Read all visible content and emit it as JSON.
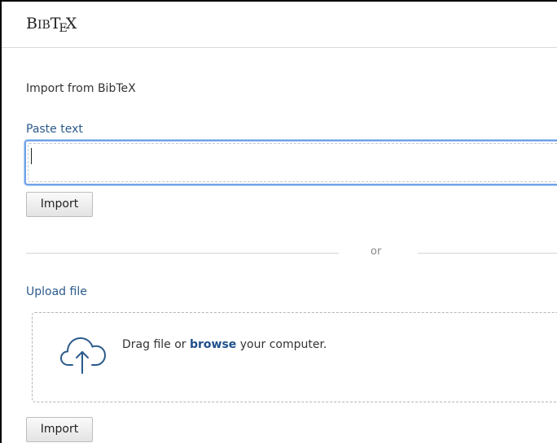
{
  "header": {
    "logo_text": "BibTeX",
    "logo_parts": {
      "b": "B",
      "ib": "IB",
      "t": "T",
      "e": "E",
      "x": "X"
    }
  },
  "page": {
    "title": "Import from BibTeX"
  },
  "paste_section": {
    "label": "Paste text",
    "value": "",
    "import_label": "Import"
  },
  "divider": {
    "text": "or"
  },
  "upload_section": {
    "label": "Upload file",
    "drop_prefix": "Drag file or ",
    "browse_link": "browse",
    "drop_suffix": " your computer.",
    "import_label": "Import",
    "icon": "cloud-upload-icon"
  },
  "colors": {
    "label_blue": "#2a5a8c",
    "link_blue": "#1f4f8a",
    "focus_blue": "#6fa2e8"
  }
}
